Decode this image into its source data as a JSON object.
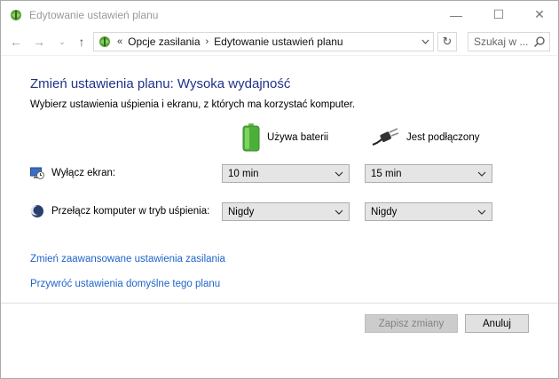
{
  "window": {
    "title": "Edytowanie ustawień planu",
    "controls": {
      "minimize": "—",
      "maximize": "☐",
      "close": "✕"
    }
  },
  "nav": {
    "back_icon": "←",
    "forward_icon": "→",
    "history_icon": "⌄",
    "up_icon": "↑",
    "address_separator": "«",
    "breadcrumbs": [
      "Opcje zasilania",
      "Edytowanie ustawień planu"
    ],
    "crumb_arrow": "›",
    "refresh_icon": "↻",
    "search_placeholder": "Szukaj w ..."
  },
  "main": {
    "heading": "Zmień ustawienia planu: Wysoka wydajność",
    "subtitle": "Wybierz ustawienia uśpienia i ekranu, z których ma korzystać komputer.",
    "columns": {
      "battery": "Używa baterii",
      "plugged": "Jest podłączony"
    },
    "rows": [
      {
        "label": "Wyłącz ekran:",
        "battery_value": "10 min",
        "plugged_value": "15 min"
      },
      {
        "label": "Przełącz komputer w tryb uśpienia:",
        "battery_value": "Nigdy",
        "plugged_value": "Nigdy"
      }
    ],
    "links": {
      "advanced": "Zmień zaawansowane ustawienia zasilania",
      "restore": "Przywróć ustawienia domyślne tego planu"
    }
  },
  "footer": {
    "save_label": "Zapisz zmiany",
    "cancel_label": "Anuluj"
  },
  "colors": {
    "heading": "#1e3287",
    "link": "#1e64c8",
    "battery_green": "#4caf3a"
  }
}
